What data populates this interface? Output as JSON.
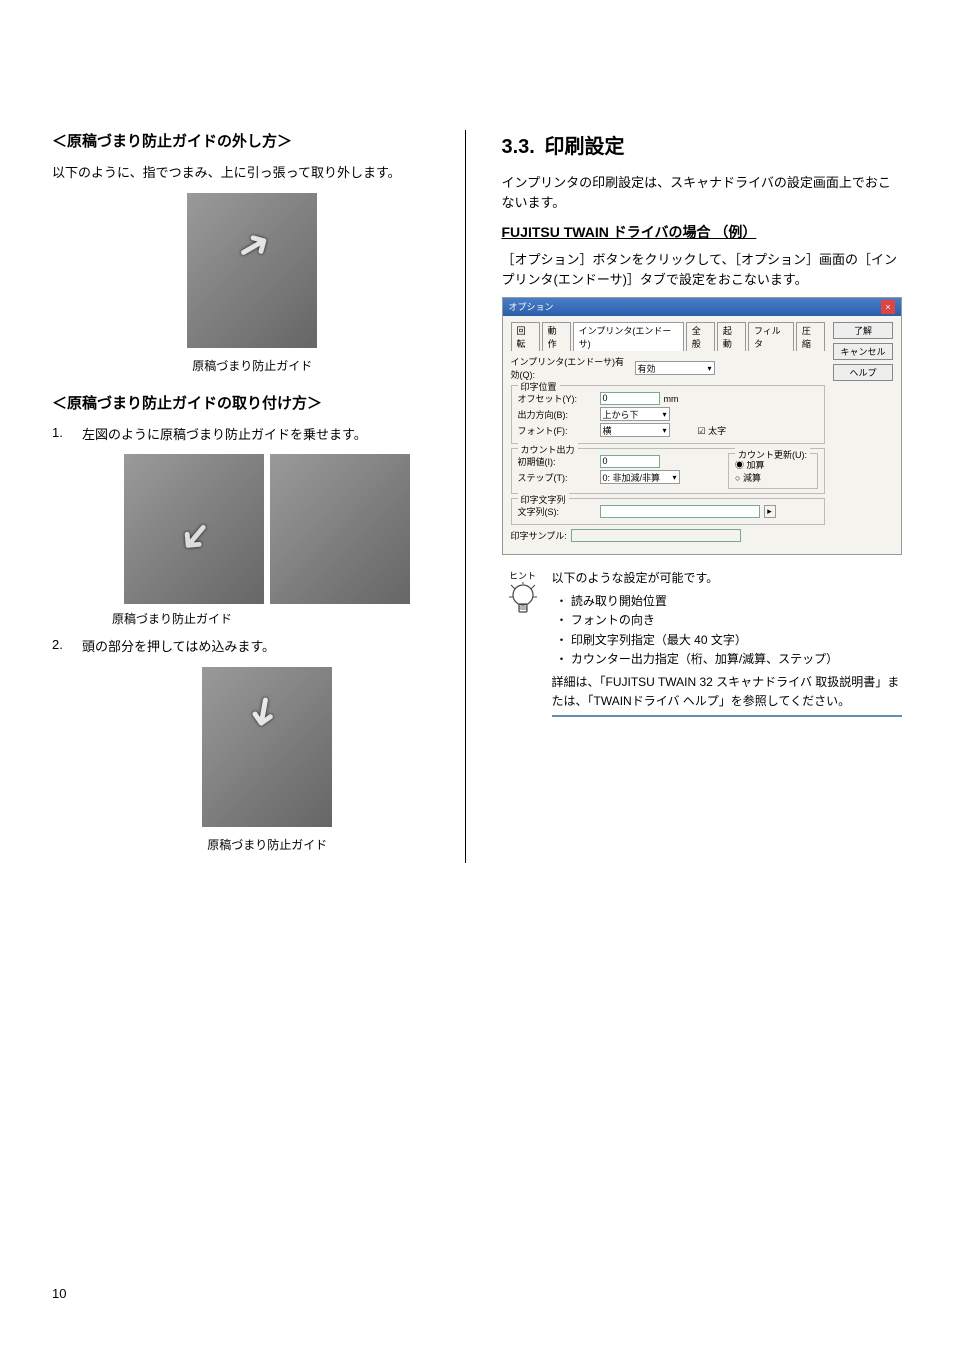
{
  "left": {
    "h1": "＜原稿づまり防止ガイドの外し方＞",
    "p1": "以下のように、指でつまみ、上に引っ張って取り外します。",
    "cap1": "原稿づまり防止ガイド",
    "h2": "＜原稿づまり防止ガイドの取り付け方＞",
    "steps": [
      {
        "num": "1.",
        "text": "左図のように原稿づまり防止ガイドを乗せます。"
      },
      {
        "num": "2.",
        "text": "頭の部分を押してはめ込みます。"
      }
    ],
    "cap2": "原稿づまり防止ガイド",
    "cap3": "原稿づまり防止ガイド"
  },
  "right": {
    "section_num": "3.3.",
    "section_title": "印刷設定",
    "p1": "インプリンタの印刷設定は、スキャナドライバの設定画面上でおこないます。",
    "subhead": "FUJITSU TWAIN ドライバの場合 （例）",
    "p2": "［オプション］ボタンをクリックして、［オプション］画面の［インプリンタ(エンドーサ)］タブで設定をおこないます。",
    "hint_label": "ヒント",
    "hint_intro": "以下のような設定が可能です。",
    "hint_items": [
      "読み取り開始位置",
      "フォントの向き",
      "印刷文字列指定（最大 40 文字）",
      "カウンター出力指定（桁、加算/減算、ステップ）"
    ],
    "hint_detail": "詳細は、「FUJITSU TWAIN 32 スキャナドライバ 取扱説明書」または、「TWAINドライバ ヘルプ」を参照してください。"
  },
  "dialog": {
    "title": "オプション",
    "tabs": [
      "回転",
      "動作",
      "インプリンタ(エンドーサ)",
      "全般",
      "起動",
      "フィルタ",
      "圧縮"
    ],
    "active_tab": "インプリンタ(エンドーサ)",
    "enable_label": "インプリンタ(エンドーサ)有効(Q):",
    "enable_value": "有効",
    "group_pos": "印字位置",
    "offset_label": "オフセット(Y):",
    "offset_value": "0",
    "offset_unit": "mm",
    "dir_label": "出力方向(B):",
    "dir_value": "上から下",
    "font_label": "フォント(F):",
    "font_value": "横",
    "bold_chk": "太字",
    "group_count": "カウント出力",
    "init_label": "初期値(I):",
    "init_value": "0",
    "step_label": "ステップ(T):",
    "step_value": "0: 非加減/非算",
    "update_group": "カウント更新(U):",
    "radio_inc": "加算",
    "radio_dec": "減算",
    "group_str": "印字文字列",
    "str_label": "文字列(S):",
    "sample_label": "印字サンプル:",
    "btn_ok": "了解",
    "btn_cancel": "キャンセル",
    "btn_help": "ヘルプ"
  },
  "page_number": "10"
}
